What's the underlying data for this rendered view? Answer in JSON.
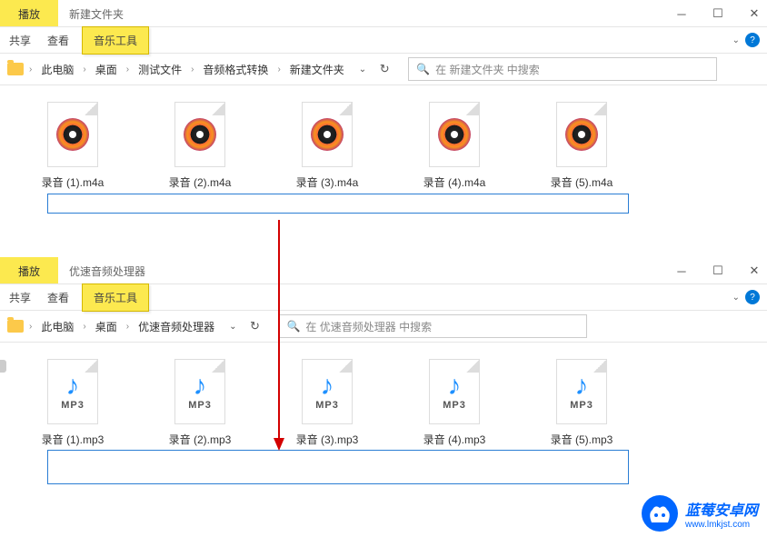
{
  "window1": {
    "play_tab": "播放",
    "title": "新建文件夹",
    "ribbon": {
      "share": "共享",
      "view": "查看",
      "music_tool": "音乐工具"
    },
    "breadcrumbs": [
      "此电脑",
      "桌面",
      "测试文件",
      "音频格式转换",
      "新建文件夹"
    ],
    "search_placeholder": "在 新建文件夹 中搜索",
    "files": [
      "录音 (1).m4a",
      "录音 (2).m4a",
      "录音 (3).m4a",
      "录音 (4).m4a",
      "录音 (5).m4a"
    ]
  },
  "window2": {
    "play_tab": "播放",
    "title": "优速音频处理器",
    "ribbon": {
      "share": "共享",
      "view": "查看",
      "music_tool": "音乐工具"
    },
    "breadcrumbs": [
      "此电脑",
      "桌面",
      "优速音频处理器"
    ],
    "search_placeholder": "在 优速音频处理器 中搜索",
    "mp3_label": "MP3",
    "files": [
      "录音 (1).mp3",
      "录音 (2).mp3",
      "录音 (3).mp3",
      "录音 (4).mp3",
      "录音 (5).mp3"
    ]
  },
  "watermark": {
    "cn": "蓝莓安卓网",
    "url": "www.lmkjst.com"
  }
}
